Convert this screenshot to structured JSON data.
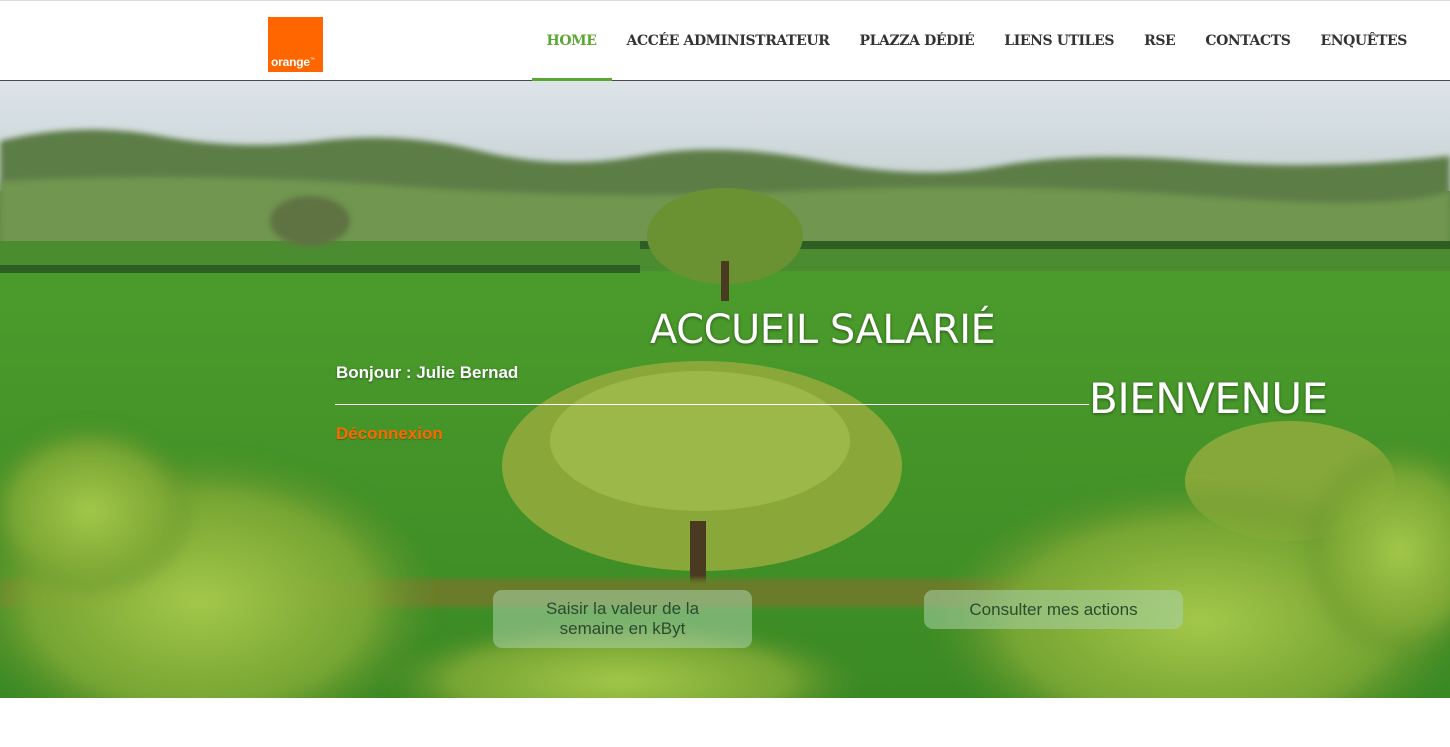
{
  "brand": {
    "logo_text": "orange",
    "logo_mark": "™",
    "color": "#ff6600"
  },
  "nav": {
    "active_color": "#5aa832",
    "items": [
      {
        "label": "HOME",
        "active": true
      },
      {
        "label": "ACCÉE ADMINISTRATEUR",
        "active": false
      },
      {
        "label": "PLAZZA DÉDIÉ",
        "active": false
      },
      {
        "label": "LIENS UTILES",
        "active": false
      },
      {
        "label": "RSE",
        "active": false
      },
      {
        "label": "CONTACTS",
        "active": false
      },
      {
        "label": "ENQUÊTES",
        "active": false
      }
    ]
  },
  "hero": {
    "title": "ACCUEIL SALARIÉ",
    "greeting": "Bonjour : Julie Bernad",
    "welcome": "BIENVENUE",
    "logout_label": "Déconnexion",
    "buttons": {
      "weekly_value": "Saisir la valeur de la semaine en kByt",
      "my_actions": "Consulter mes actions"
    }
  }
}
